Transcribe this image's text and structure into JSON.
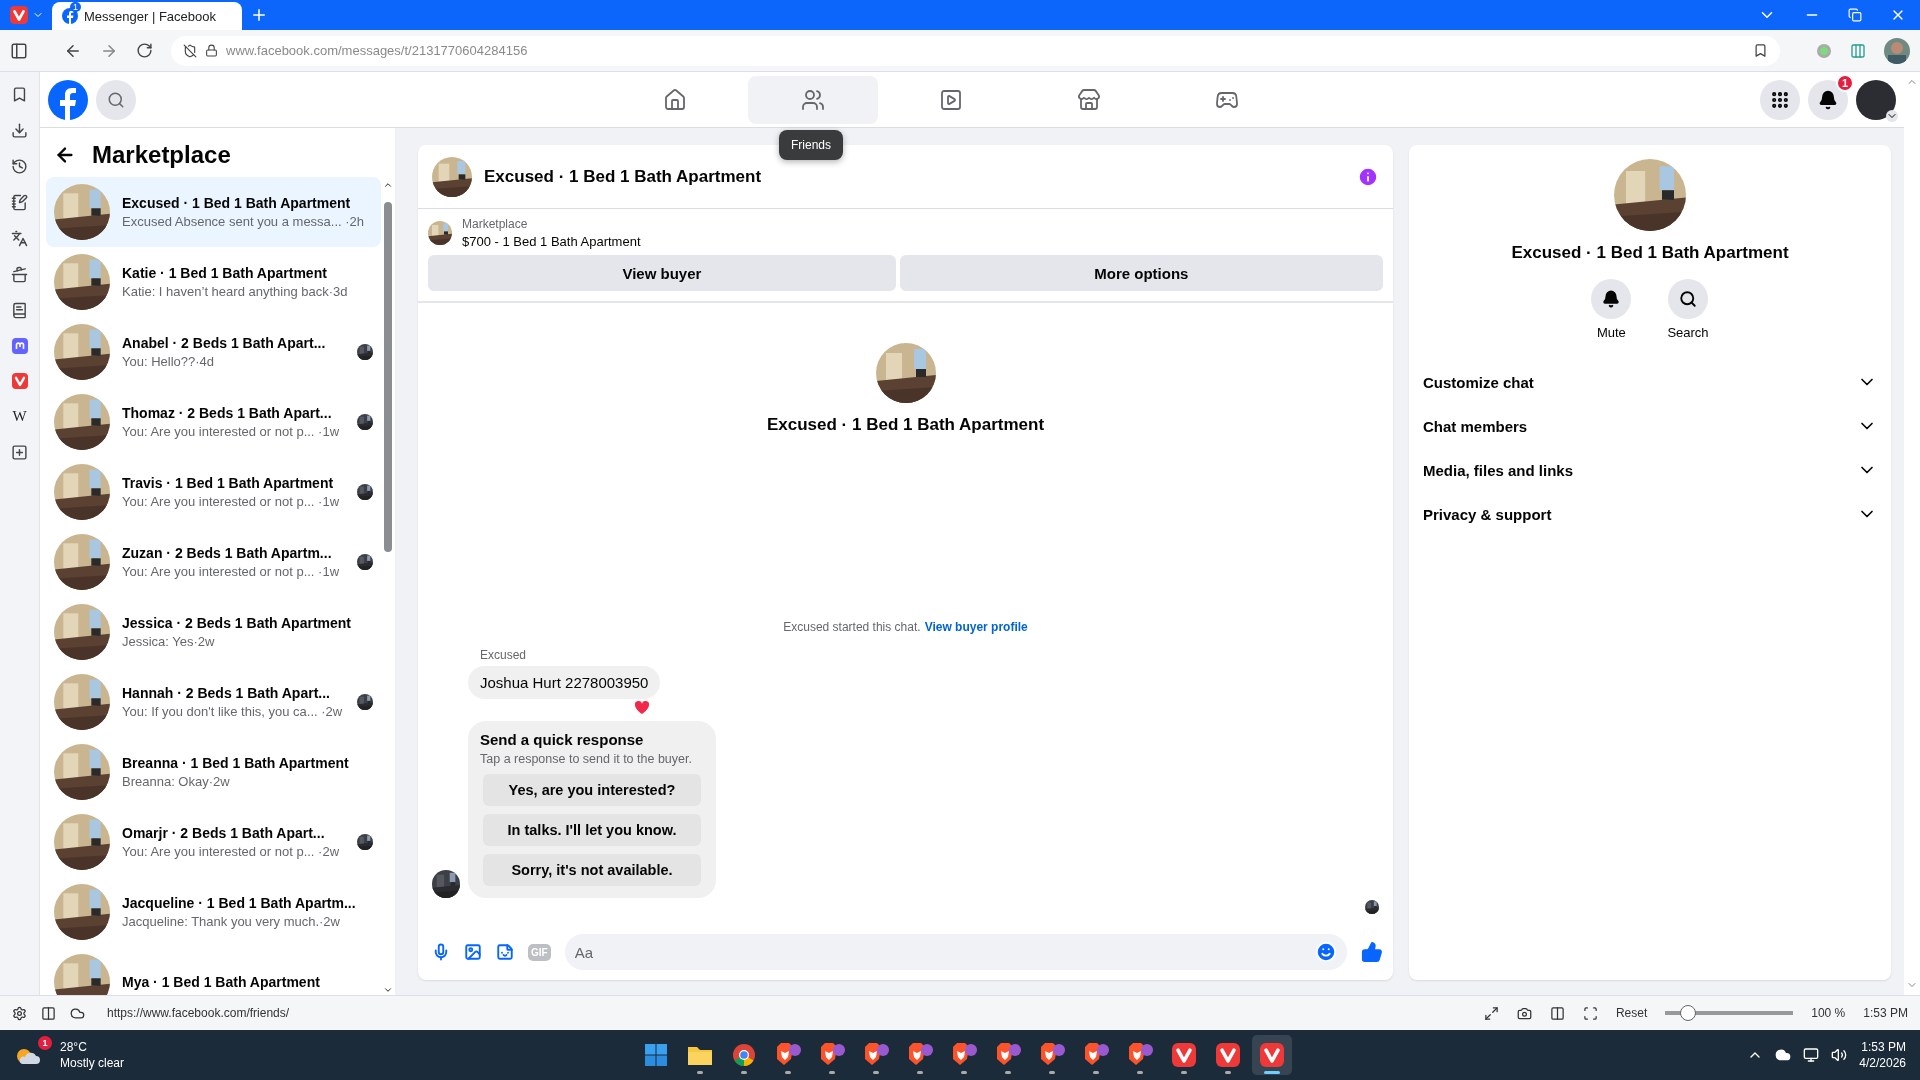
{
  "browser": {
    "tabs": [
      {
        "title": "Messenger | Facebook",
        "badge": "1",
        "selected": true
      }
    ],
    "url": "www.facebook.com/messages/t/2131770604284156",
    "web_panel_label": "W"
  },
  "facebook": {
    "nav": [
      {
        "kind": "home",
        "hovered": false
      },
      {
        "kind": "friends",
        "hovered": true,
        "tooltip": "Friends"
      },
      {
        "kind": "video",
        "hovered": false
      },
      {
        "kind": "marketplace",
        "hovered": false
      },
      {
        "kind": "gaming",
        "hovered": false
      }
    ],
    "notification_badge": "1"
  },
  "inbox": {
    "title": "Marketplace",
    "conversations": [
      {
        "name": "Excused · 1 Bed 1 Bath Apartment",
        "subtitle": "Excused Absence sent you a messa... ·2h",
        "selected": true,
        "seen": false
      },
      {
        "name": "Katie · 1 Bed 1 Bath Apartment",
        "subtitle": "Katie: I haven’t heard anything back·3d",
        "selected": false,
        "seen": false
      },
      {
        "name": "Anabel · 2 Beds 1 Bath Apart...",
        "subtitle": "You: Hello??·4d",
        "selected": false,
        "seen": true
      },
      {
        "name": "Thomaz · 2 Beds 1 Bath Apart...",
        "subtitle": "You: Are you interested or not p... ·1w",
        "selected": false,
        "seen": true
      },
      {
        "name": "Travis · 1 Bed 1 Bath Apartment",
        "subtitle": "You: Are you interested or not p... ·1w",
        "selected": false,
        "seen": true
      },
      {
        "name": "Zuzan · 2 Beds 1 Bath Apartm...",
        "subtitle": "You: Are you interested or not p... ·1w",
        "selected": false,
        "seen": true
      },
      {
        "name": "Jessica · 2 Beds 1 Bath Apartment",
        "subtitle": "Jessica: Yes·2w",
        "selected": false,
        "seen": false
      },
      {
        "name": "Hannah · 2 Beds 1 Bath Apart...",
        "subtitle": "You: If you don't like this, you ca... ·2w",
        "selected": false,
        "seen": true
      },
      {
        "name": "Breanna · 1 Bed 1 Bath Apartment",
        "subtitle": "Breanna: Okay·2w",
        "selected": false,
        "seen": false
      },
      {
        "name": "Omarjr · 2 Beds 1 Bath Apart...",
        "subtitle": "You: Are you interested or not p... ·2w",
        "selected": false,
        "seen": true
      },
      {
        "name": "Jacqueline · 1 Bed 1 Bath Apartm...",
        "subtitle": "Jacqueline: Thank you very much.·2w",
        "selected": false,
        "seen": false
      },
      {
        "name": "Mya · 1 Bed 1 Bath Apartment",
        "selected": false,
        "seen": false
      }
    ]
  },
  "chat": {
    "title": "Excused · 1 Bed 1 Bath Apartment",
    "listing": {
      "source": "Marketplace",
      "item": "$700 - 1 Bed 1 Bath Apartment"
    },
    "actions": [
      "View buyer",
      "More options"
    ],
    "profile_name": "Excused · 1 Bed 1 Bath Apartment",
    "system_note": "Excused started this chat.",
    "system_link": "View buyer profile",
    "messages": [
      {
        "sender": "Excused",
        "text": "Joshua Hurt 2278003950",
        "reacted": true
      }
    ],
    "quick_response": {
      "title": "Send a quick response",
      "hint": "Tap a response to send it to the buyer.",
      "options": [
        "Yes, are you interested?",
        "In talks. I'll let you know.",
        "Sorry, it's not available."
      ]
    },
    "composer": {
      "placeholder": "Aa",
      "gif_label": "GIF"
    }
  },
  "details": {
    "title": "Excused · 1 Bed 1 Bath Apartment",
    "actions": [
      {
        "kind": "mute",
        "label": "Mute"
      },
      {
        "kind": "search",
        "label": "Search"
      }
    ],
    "sections": [
      {
        "label": "Customize chat",
        "expanded": false
      },
      {
        "label": "Chat members",
        "expanded": false
      },
      {
        "label": "Media, files and links",
        "expanded": false
      },
      {
        "label": "Privacy & support",
        "expanded": false
      }
    ]
  },
  "status_bar": {
    "url": "https://www.facebook.com/friends/",
    "reset": "Reset",
    "level": 0.18,
    "zoom": "100 %",
    "time": "1:53 PM"
  },
  "taskbar": {
    "temperature": "28°C",
    "condition": "Mostly clear",
    "weather_badge": "1",
    "apps": [
      {
        "kind": "start",
        "running": false,
        "selected": false
      },
      {
        "kind": "folder",
        "running": true,
        "selected": false
      },
      {
        "kind": "chrome",
        "running": true,
        "selected": false
      },
      {
        "kind": "brave",
        "running": true,
        "selected": false
      },
      {
        "kind": "brave",
        "running": true,
        "selected": false
      },
      {
        "kind": "brave",
        "running": true,
        "selected": false
      },
      {
        "kind": "brave",
        "running": true,
        "selected": false
      },
      {
        "kind": "brave",
        "running": true,
        "selected": false
      },
      {
        "kind": "brave",
        "running": true,
        "selected": false
      },
      {
        "kind": "brave",
        "running": true,
        "selected": false
      },
      {
        "kind": "brave",
        "running": true,
        "selected": false
      },
      {
        "kind": "brave",
        "running": true,
        "selected": false
      },
      {
        "kind": "vivaldi",
        "running": true,
        "selected": false
      },
      {
        "kind": "vivaldi",
        "running": true,
        "selected": false
      },
      {
        "kind": "vivaldi",
        "running": true,
        "selected": true
      }
    ],
    "time": "1:53 PM",
    "date": "4/2/2026"
  }
}
